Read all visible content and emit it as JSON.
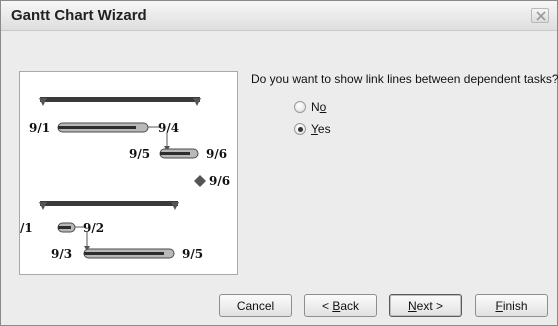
{
  "window": {
    "title": "Gantt Chart Wizard"
  },
  "preview": {
    "labels": {
      "task1_start": "9/1",
      "task1_end": "9/4",
      "task2_start": "9/5",
      "task2_end": "9/6",
      "milestone": "9/6",
      "task3_start": "/1",
      "task3_end": "9/2",
      "task4_start": "9/3",
      "task4_end": "9/5"
    }
  },
  "question": "Do you want to show link lines between dependent tasks?",
  "options": [
    {
      "label_pre": "N",
      "label_mnemonic": "o",
      "label_post": "",
      "selected": false
    },
    {
      "label_pre": "",
      "label_mnemonic": "Y",
      "label_post": "es",
      "selected": true
    }
  ],
  "buttons": {
    "cancel": "Cancel",
    "back": {
      "pre": "< ",
      "mnemonic": "B",
      "post": "ack"
    },
    "next": {
      "pre": "",
      "mnemonic": "N",
      "post": "ext >"
    },
    "finish": {
      "pre": "",
      "mnemonic": "F",
      "post": "inish"
    }
  }
}
